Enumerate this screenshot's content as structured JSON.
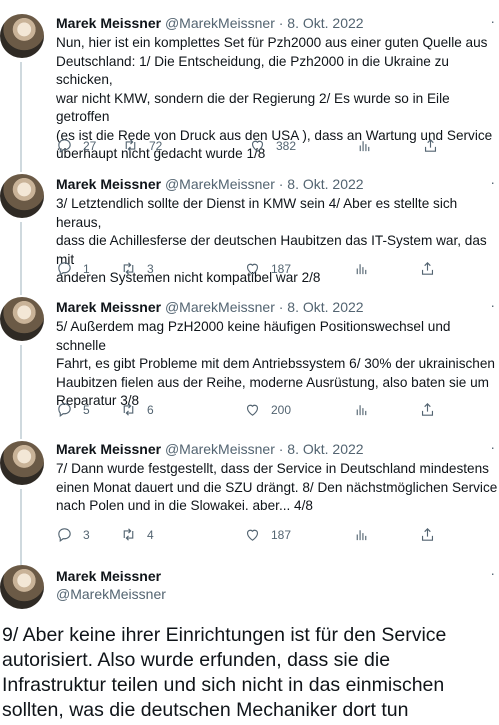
{
  "tweets": [
    {
      "name": "Marek Meissner",
      "handle": "@MarekMeissner",
      "date": "· 8. Okt. 2022",
      "text": "Nun, hier ist ein komplettes Set für Pzh2000 aus einer guten Quelle aus\nDeutschland: 1/ Die Entscheidung, die Pzh2000 in die Ukraine zu schicken,\nwar nicht KMW, sondern die der Regierung 2/ Es wurde so in Eile getroffen\n(es ist die Rede von Druck aus den USA ), dass an Wartung und Service\nüberhaupt nicht gedacht wurde 1/8",
      "replies": "27",
      "retweets": "72",
      "likes": "382"
    },
    {
      "name": "Marek Meissner",
      "handle": "@MarekMeissner",
      "date": "· 8. Okt. 2022",
      "text": "3/ Letztendlich sollte der Dienst in KMW sein 4/ Aber es stellte sich heraus,\ndass die Achillesferse der deutschen Haubitzen das IT-System war, das mit\nanderen Systemen nicht kompatibel war 2/8",
      "replies": "1",
      "retweets": "3",
      "likes": "187"
    },
    {
      "name": "Marek Meissner",
      "handle": "@MarekMeissner",
      "date": "· 8. Okt. 2022",
      "text": "5/ Außerdem mag PzH2000 keine häufigen Positionswechsel und schnelle\nFahrt, es gibt Probleme mit dem Antriebssystem 6/ 30% der ukrainischen\nHaubitzen fielen aus der Reihe, moderne Ausrüstung, also baten sie um\nReparatur 3/8",
      "replies": "5",
      "retweets": "6",
      "likes": "200"
    },
    {
      "name": "Marek Meissner",
      "handle": "@MarekMeissner",
      "date": "· 8. Okt. 2022",
      "text": "7/ Dann wurde festgestellt, dass der Service in Deutschland mindestens\neinen Monat dauert und die SZU drängt. 8/ Den nächstmöglichen Service\nnach Polen und in die Slowakei. aber... 4/8",
      "replies": "3",
      "retweets": "4",
      "likes": "187"
    }
  ],
  "focus_tweet": {
    "name": "Marek Meissner",
    "handle": "@MarekMeissner",
    "text": "9/ Aber keine ihrer Einrichtungen ist für den Service\nautorisiert. Also wurde erfunden, dass sie die\nInfrastruktur teilen und sich nicht in das einmischen\nsollten, was die deutschen Mechaniker dort tun"
  },
  "icons": {
    "reply": "reply-icon",
    "retweet": "retweet-icon",
    "like": "heart-icon",
    "views": "views-icon",
    "share": "share-icon",
    "more": "more-icon"
  },
  "more_glyph": "·"
}
